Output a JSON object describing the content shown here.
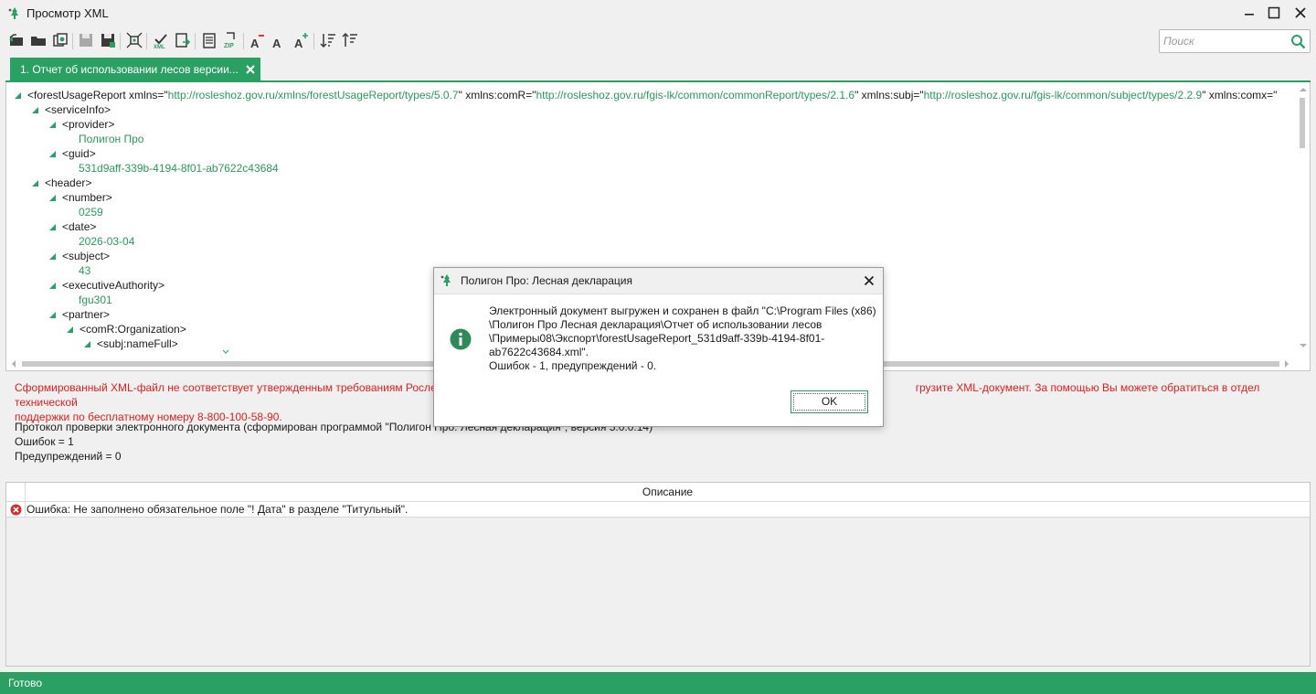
{
  "window": {
    "title": "Просмотр XML",
    "icon": "app-tree-icon"
  },
  "toolbar": {
    "buttons": [
      "open-back-icon",
      "open-folder-icon",
      "copy-icon",
      "save-disabled-icon",
      "save-as-icon",
      "expand-icon",
      "xml-check-icon",
      "export-icon",
      "report-icon",
      "zip-icon",
      "font-decrease-icon",
      "font-normal-icon",
      "font-increase-icon",
      "sort-desc-icon",
      "sort-asc-icon"
    ],
    "search_placeholder": "Поиск"
  },
  "tabs": [
    {
      "label": "1. Отчет об использовании лесов версии..."
    }
  ],
  "xml": {
    "root_open": "<forestUsageReport xmlns=\"",
    "ns1": "http://rosleshoz.gov.ru/xmlns/forestUsageReport/types/5.0.7",
    "ns1_after": "\" xmlns:comR=\"",
    "ns2": "http://rosleshoz.gov.ru/fgis-lk/common/commonReport/types/2.1.6",
    "ns2_after": "\" xmlns:subj=\"",
    "ns3": "http://rosleshoz.gov.ru/fgis-lk/common/subject/types/2.2.9",
    "ns3_after": "\" xmlns:comx=\"",
    "lines": [
      {
        "text": "<serviceInfo>",
        "kind": "tag"
      },
      {
        "text": "<provider>",
        "kind": "tag"
      },
      {
        "text": "Полигон Про",
        "kind": "val"
      },
      {
        "text": "<guid>",
        "kind": "tag"
      },
      {
        "text": "531d9aff-339b-4194-8f01-ab7622c43684",
        "kind": "val"
      },
      {
        "text": "<header>",
        "kind": "tag"
      },
      {
        "text": "<number>",
        "kind": "tag"
      },
      {
        "text": "0259",
        "kind": "val"
      },
      {
        "text": "<date>",
        "kind": "tag"
      },
      {
        "text": "2026-03-04",
        "kind": "val"
      },
      {
        "text": "<subject>",
        "kind": "tag"
      },
      {
        "text": "43",
        "kind": "val"
      },
      {
        "text": "<executiveAuthority>",
        "kind": "tag"
      },
      {
        "text": "fgu301",
        "kind": "val"
      },
      {
        "text": "<partner>",
        "kind": "tag"
      },
      {
        "text": "<comR:Organization>",
        "kind": "tag"
      },
      {
        "text": "<subj:nameFull>",
        "kind": "tag"
      }
    ]
  },
  "messages": {
    "error_line1_a": "Сформированный XML-файл не соответствует утвержденным требованиям Рослес",
    "error_line1_b": "грузите XML-документ. За помощью Вы можете обратиться в отдел технической",
    "error_line2": "поддержки по бесплатному номеру 8-800-100-58-90.",
    "protocol_a": "Протокол проверки электронного документа (сформирован программой \"Полигон Про: Лесная декларация\", версия 5.0.0.14)",
    "errors": "Ошибок = 1",
    "warnings": "Предупреждений = 0"
  },
  "grid": {
    "header": "Описание",
    "rows": [
      {
        "icon": "error-icon",
        "text": "Ошибка: Не заполнено обязательное поле \"! Дата\" в разделе \"Титульный\"."
      }
    ]
  },
  "status": {
    "text": "Готово"
  },
  "dialog": {
    "title": "Полигон Про: Лесная декларация",
    "icon": "info-icon",
    "lines": [
      "Электронный документ выгружен и сохранен в файл \"C:\\Program Files (x86)",
      "\\Полигон Про Лесная декларация\\Отчет об использовании лесов",
      "\\Примеры08\\Экспорт\\forestUsageReport_531d9aff-339b-4194-8f01-",
      "ab7622c43684.xml\".",
      "Ошибок - 1, предупреждений - 0."
    ],
    "ok_label": "OK"
  },
  "colors": {
    "accent": "#2ba063",
    "error": "#e02020",
    "xml_value": "#2a9a5a"
  }
}
